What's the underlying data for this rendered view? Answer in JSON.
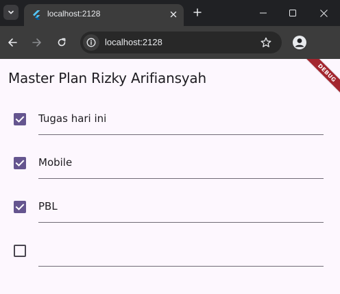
{
  "browser": {
    "tab_title": "localhost:2128",
    "url": "localhost:2128"
  },
  "app": {
    "title": "Master Plan Rizky Arifiansyah",
    "debug_banner": "DEBUG",
    "accent_color": "#65558f"
  },
  "tasks": [
    {
      "description": "Tugas hari ini",
      "complete": true
    },
    {
      "description": "Mobile",
      "complete": true
    },
    {
      "description": "PBL",
      "complete": true
    },
    {
      "description": "",
      "complete": false
    }
  ]
}
